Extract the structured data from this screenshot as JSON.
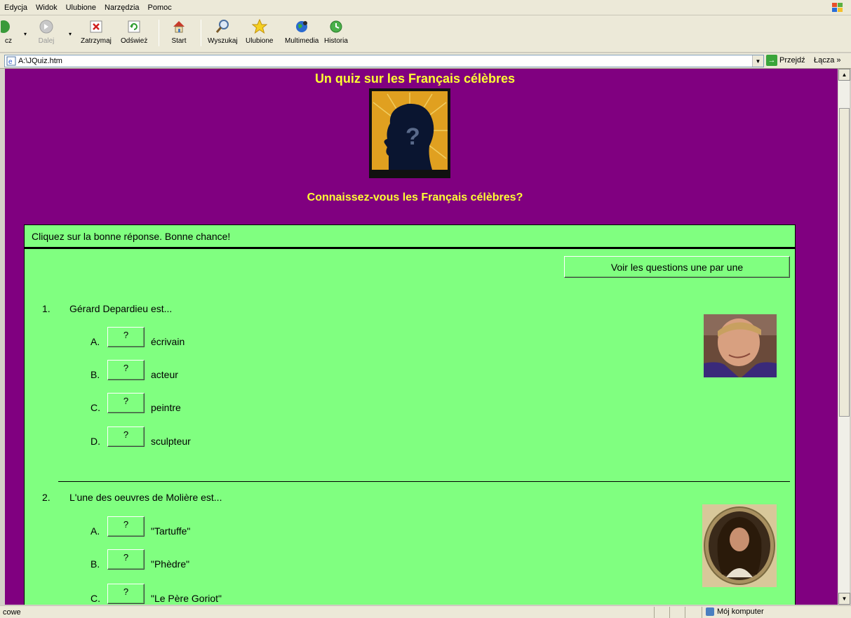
{
  "menu": [
    "Edycja",
    "Widok",
    "Ulubione",
    "Narzędzia",
    "Pomoc"
  ],
  "toolbar": {
    "back_label": "cz",
    "forward_label": "Dalej",
    "stop_label": "Zatrzymaj",
    "refresh_label": "Odśwież",
    "home_label": "Start",
    "search_label": "Wyszukaj",
    "favorites_label": "Ulubione",
    "media_label": "Multimedia",
    "history_label": "Historia"
  },
  "address": {
    "url": "A:\\JQuiz.htm",
    "go_label": "Przejdź",
    "links_label": "Łącza"
  },
  "page": {
    "title": "Un quiz sur les Français célèbres",
    "subtitle": "Connaissez-vous les Français célèbres?",
    "instructions": "Cliquez sur la bonne réponse. Bonne chance!",
    "view_button": "Voir les questions une par une",
    "questions": [
      {
        "number": "1.",
        "text": "Gérard Depardieu est...",
        "options": [
          {
            "letter": "A.",
            "button": "?",
            "text": "écrivain"
          },
          {
            "letter": "B.",
            "button": "?",
            "text": "acteur"
          },
          {
            "letter": "C.",
            "button": "?",
            "text": "peintre"
          },
          {
            "letter": "D.",
            "button": "?",
            "text": "sculpteur"
          }
        ]
      },
      {
        "number": "2.",
        "text": "L'une des oeuvres de Molière est...",
        "options": [
          {
            "letter": "A.",
            "button": "?",
            "text": "\"Tartuffe\""
          },
          {
            "letter": "B.",
            "button": "?",
            "text": "\"Phèdre\""
          },
          {
            "letter": "C.",
            "button": "?",
            "text": "\"Le Père Goriot\""
          }
        ]
      }
    ]
  },
  "status": {
    "left_text": "cowe",
    "zone_label": "Mój komputer"
  },
  "colors": {
    "page_background": "#800080",
    "title_color": "#ffff33",
    "quiz_background": "#80ff80"
  }
}
